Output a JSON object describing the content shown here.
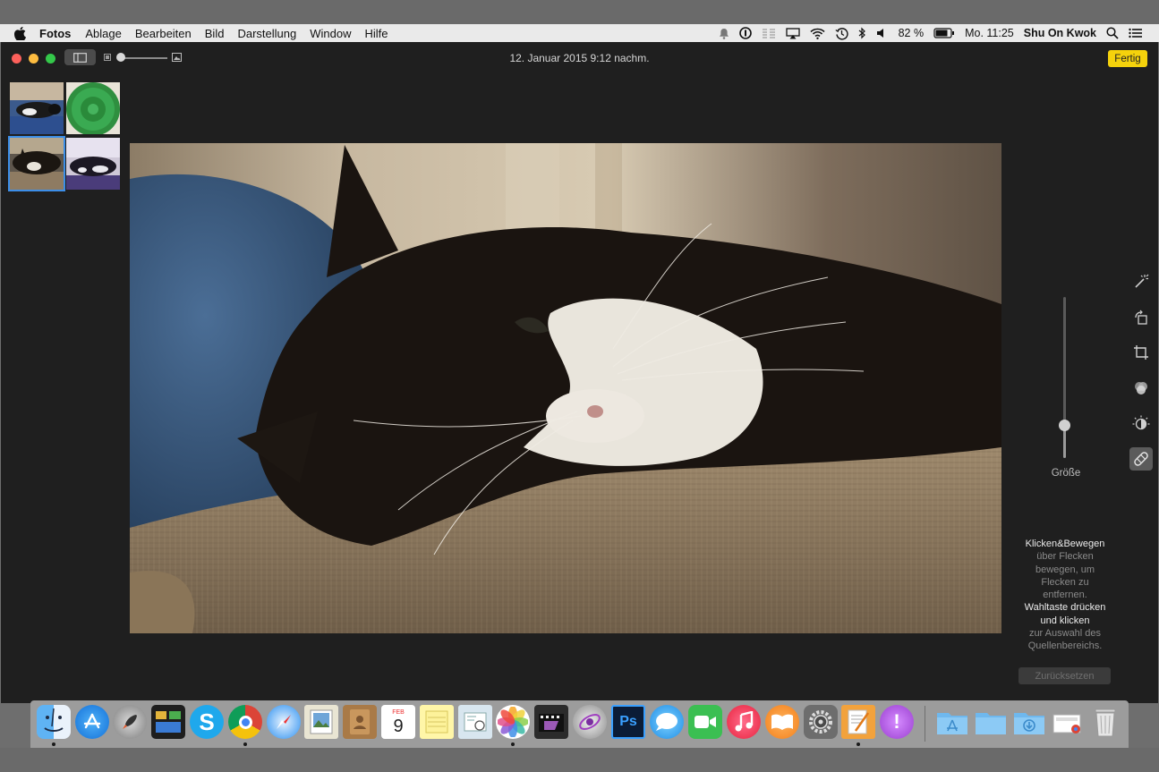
{
  "menubar": {
    "app_name": "Fotos",
    "items": [
      "Ablage",
      "Bearbeiten",
      "Bild",
      "Darstellung",
      "Window",
      "Hilfe"
    ],
    "battery": "82 %",
    "clock": "Mo. 11:25",
    "user": "Shu On Kwok",
    "status_icons": [
      "notification-icon",
      "1password-icon",
      "bars-icon",
      "airplay-icon",
      "wifi-icon",
      "time-machine-icon",
      "bluetooth-icon",
      "volume-icon",
      "battery-icon",
      "spotlight-icon",
      "list-icon"
    ]
  },
  "window": {
    "title": "12. Januar 2015 9:12 nachm.",
    "done_label": "Fertig",
    "thumbnails": [
      {
        "name": "cat-on-blue-blanket",
        "selected": false
      },
      {
        "name": "green-plate",
        "selected": false
      },
      {
        "name": "cat-sleeping-closeup",
        "selected": true
      },
      {
        "name": "cat-lying-window",
        "selected": false
      }
    ]
  },
  "retouch": {
    "size_label": "Größe",
    "size_value": 0.2,
    "help_1_bold": "Klicken&Bewegen",
    "help_1_text": [
      "über Flecken",
      "bewegen, um",
      "Flecken zu",
      "entfernen."
    ],
    "help_2_bold": [
      "Wahltaste drücken",
      "und klicken"
    ],
    "help_2_text": [
      "zur Auswahl des",
      "Quellenbereichs."
    ],
    "reset_label": "Zurücksetzen",
    "tools": [
      "enhance-icon",
      "rotate-icon",
      "crop-icon",
      "filters-icon",
      "adjust-icon",
      "retouch-icon"
    ],
    "active_tool": "retouch-icon"
  },
  "dock": {
    "apps": [
      "Finder",
      "App Store",
      "Launchpad",
      "Mission Control",
      "Skype",
      "Chrome",
      "Safari",
      "Vorschau",
      "Kontakte",
      "Kalender",
      "Notizen",
      "Bildschirmfoto",
      "Fotos",
      "Final Cut Pro",
      "Motion",
      "Photoshop",
      "Nachrichten",
      "FaceTime",
      "iTunes",
      "iBooks",
      "Systemeinstellungen",
      "Pages",
      "Podcast"
    ],
    "calendar_month": "FEB",
    "calendar_day": "9",
    "photoshop_label": "Ps"
  },
  "colors": {
    "accent_yellow": "#f5d20c",
    "selection_blue": "#3c8ee8",
    "window_bg": "#1f1f1f"
  }
}
